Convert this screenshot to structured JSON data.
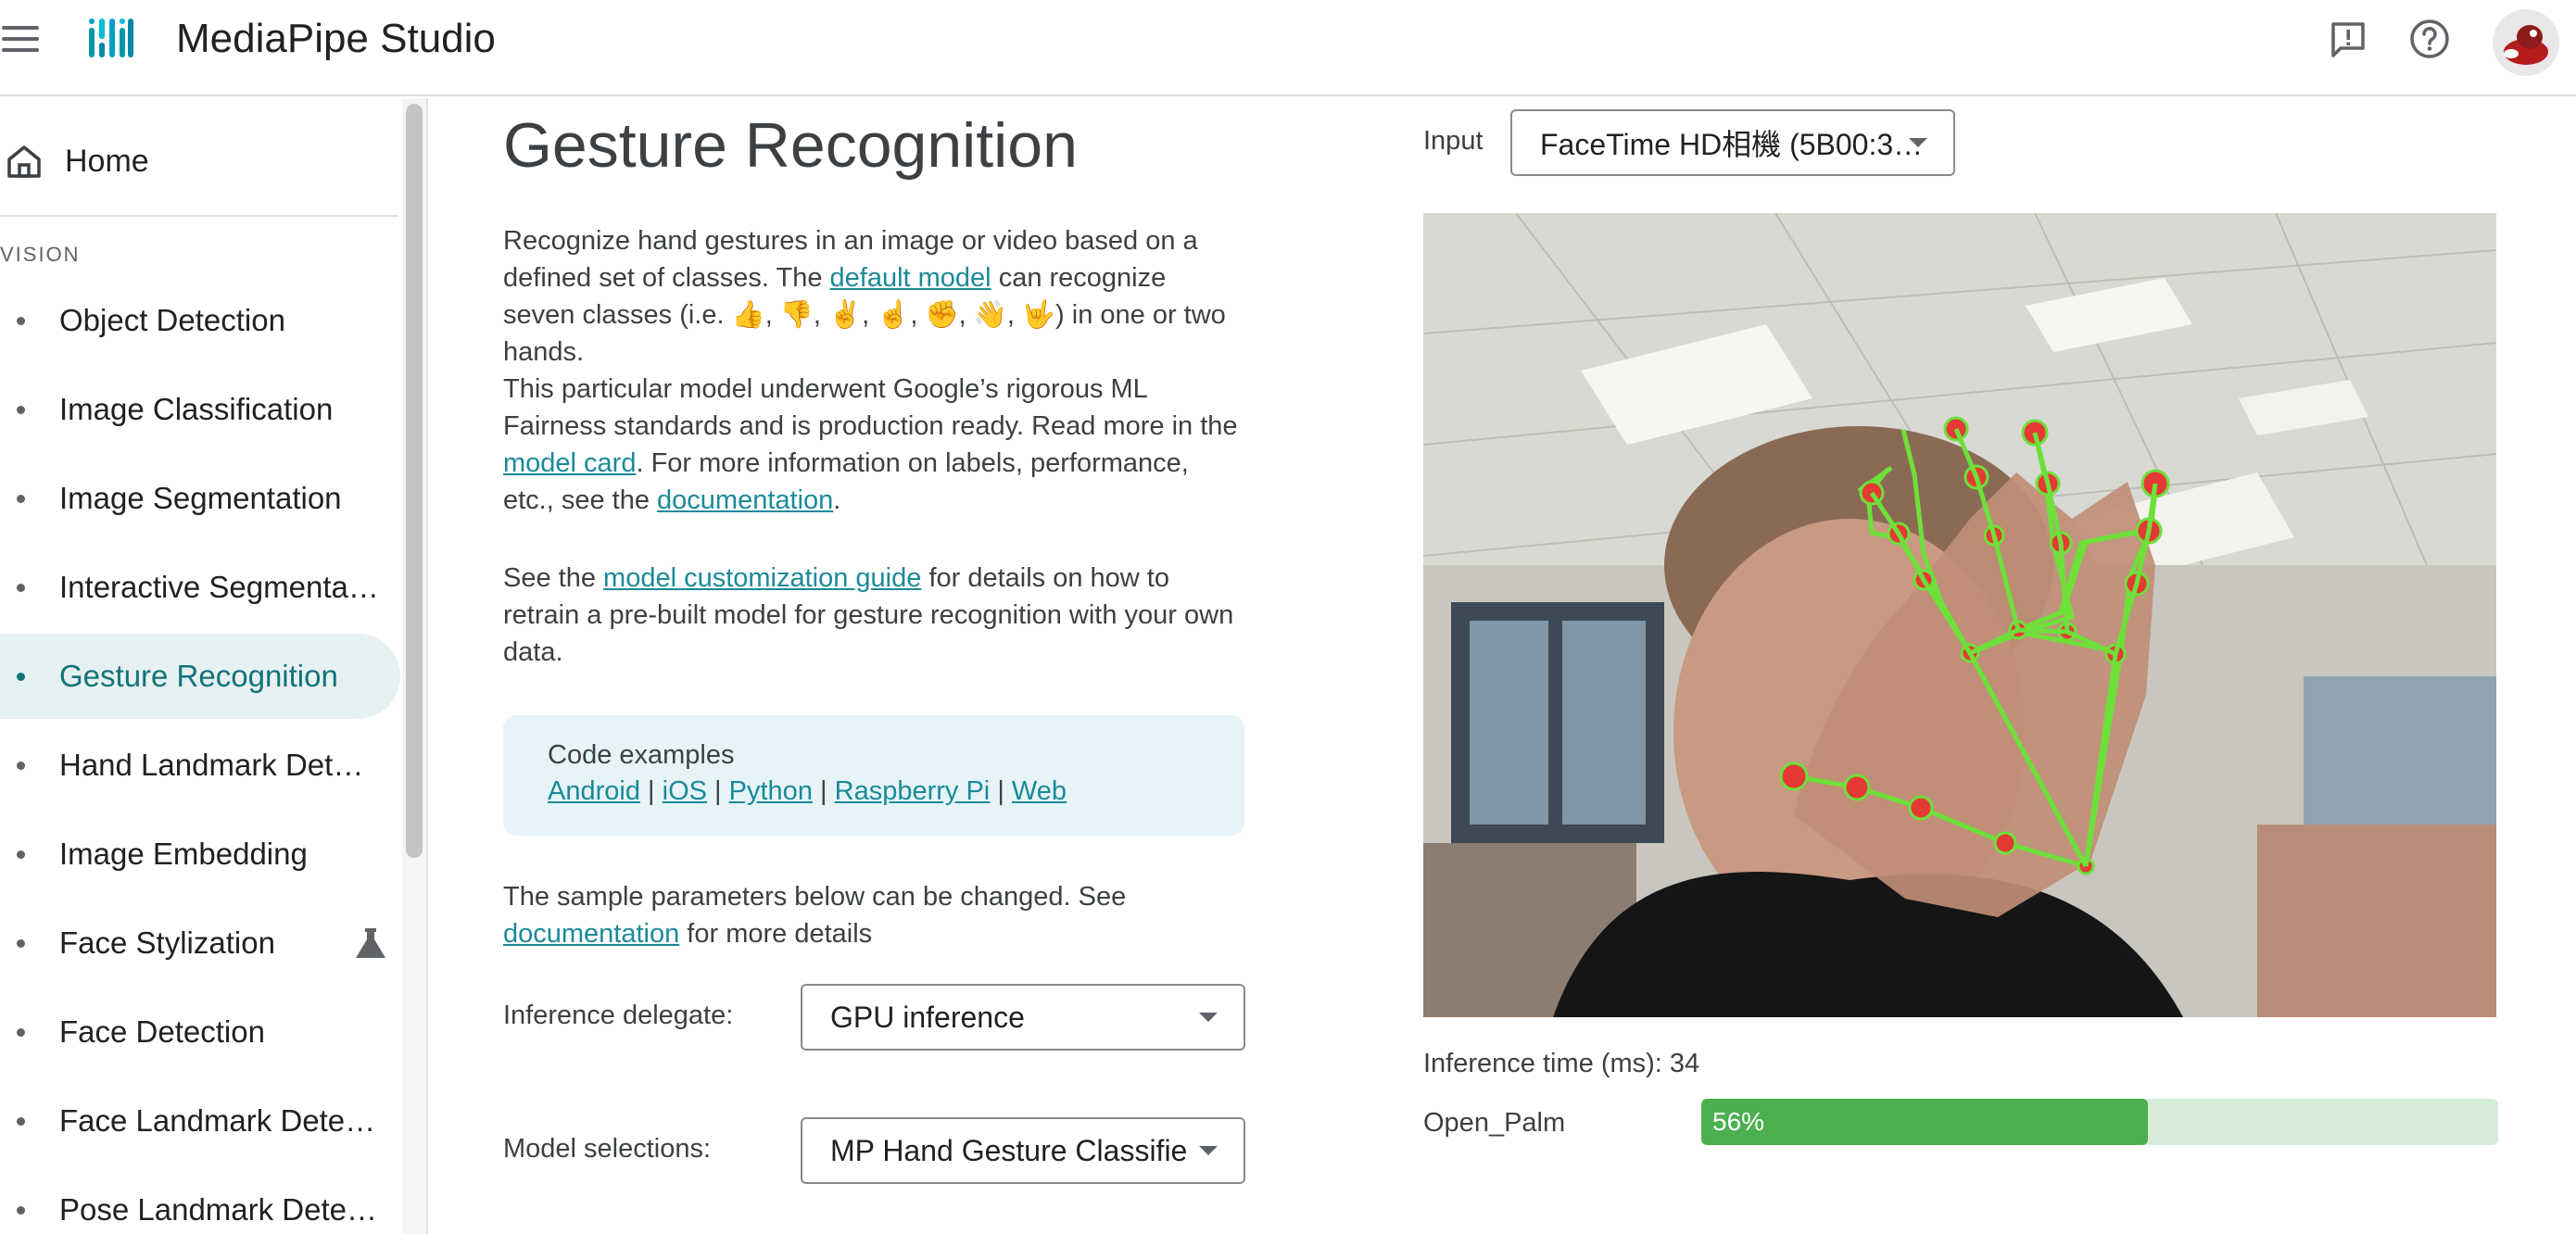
{
  "app": {
    "title": "MediaPipe Studio"
  },
  "sidebar": {
    "home_label": "Home",
    "section_label": "VISION",
    "items": [
      {
        "label": "Object Detection"
      },
      {
        "label": "Image Classification"
      },
      {
        "label": "Image Segmentation"
      },
      {
        "label": "Interactive Segmentation"
      },
      {
        "label": "Gesture Recognition",
        "active": true
      },
      {
        "label": "Hand Landmark Detection"
      },
      {
        "label": "Image Embedding"
      },
      {
        "label": "Face Stylization",
        "icon": "flask-icon"
      },
      {
        "label": "Face Detection"
      },
      {
        "label": "Face Landmark Detection"
      },
      {
        "label": "Pose Landmark Detection"
      }
    ]
  },
  "main": {
    "title": "Gesture Recognition",
    "intro": {
      "text1": "Recognize hand gestures in an image or video based on a defined set of classes. The ",
      "link1": "default model",
      "text2": " can recognize seven classes (i.e. 👍, 👎, ✌️, ☝️, ✊, 👋, 🤟) in one or two hands."
    },
    "fairness": {
      "text1": "This particular model underwent Google’s rigorous ML Fairness standards and is production ready. Read more in the ",
      "link1": "model card",
      "text2": ". For more information on labels, performance, etc., see the ",
      "link2": "documentation",
      "text3": "."
    },
    "customize": {
      "text1": "See the ",
      "link1": "model customization guide",
      "text2": " for details on how to retrain a pre-built model for gesture recognition with your own data."
    },
    "code_examples": {
      "title": "Code examples",
      "links": [
        "Android",
        "iOS",
        "Python",
        "Raspberry Pi",
        "Web"
      ],
      "separator": "|"
    },
    "params": {
      "text1": "The sample parameters below can be changed. See ",
      "link1": "documentation",
      "text2": " for more details"
    },
    "inference_delegate": {
      "label": "Inference delegate:",
      "value": "GPU inference"
    },
    "model_selection": {
      "label": "Model selections:",
      "value": "MP Hand Gesture Classifier"
    }
  },
  "right": {
    "input_label": "Input",
    "input_value": "FaceTime HD相機 (5B00:3…",
    "inference_time_label": "Inference time (ms): 34",
    "result": {
      "gesture": "Open_Palm",
      "score_text": "56%",
      "score": 0.56
    }
  },
  "colors": {
    "accent": "#12737a",
    "link": "#1a8a98",
    "landmark_point": "#e53935",
    "landmark_line": "#6ee03a",
    "bar_fill": "#4caf50",
    "bar_track": "#d7ecd8"
  },
  "icons": {
    "menu": "menu-icon",
    "logo": "mediapipe-logo",
    "feedback": "feedback-icon",
    "help": "help-icon",
    "home": "home-icon",
    "flask": "flask-icon"
  }
}
